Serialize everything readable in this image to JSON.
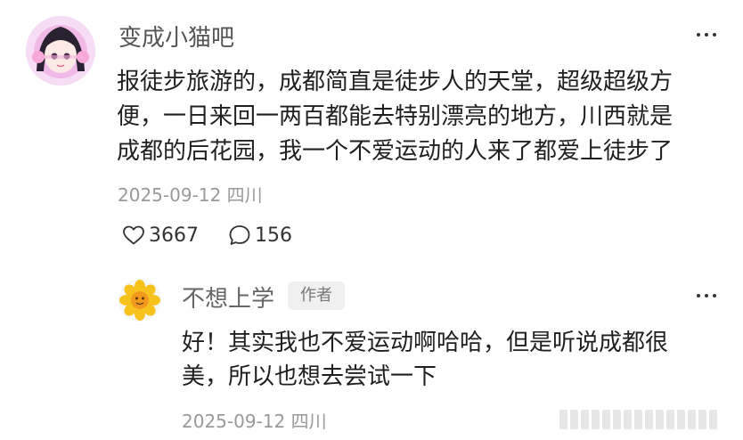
{
  "comment": {
    "username": "变成小猫吧",
    "text_lines": [
      "报徒步旅游的，成都简直是徒步人的天堂，超级超级方",
      "便，一日来回一两百都能去特别漂亮的地方，川西就是",
      "成都的后花园，我一个不爱运动的人来了都爱上徒步了"
    ],
    "meta": "2025-09-12 四川",
    "likes": "3667",
    "comments": "156",
    "more_icon": "more-horizontal-icon"
  },
  "reply": {
    "username": "不想上学",
    "badge": "作者",
    "text_lines": [
      "好！其实我也不爱运动啊哈哈，但是听说成都很",
      "美，所以也想去尝试一下"
    ],
    "meta": "2025-09-12 四川",
    "more_icon": "more-horizontal-icon"
  },
  "icons": {
    "like": "heart-outline-icon",
    "comment": "speech-bubble-icon"
  },
  "colors": {
    "text": "#1f1f1f",
    "username": "#555555",
    "meta": "#999999"
  }
}
